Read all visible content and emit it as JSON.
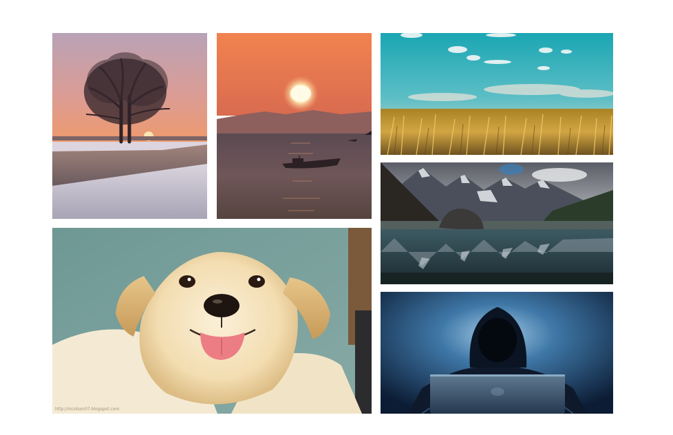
{
  "gallery": {
    "tiles": [
      {
        "id": "tree",
        "subject": "bare-tree-winter-sunset"
      },
      {
        "id": "sun",
        "subject": "sunset-over-sea-with-boat"
      },
      {
        "id": "field",
        "subject": "golden-grass-field-blue-sky"
      },
      {
        "id": "mtn",
        "subject": "mountain-lake-reflection"
      },
      {
        "id": "puppy",
        "subject": "smiling-labrador-puppy",
        "watermark": "http://nicolson07.blogspot.com"
      },
      {
        "id": "hacker",
        "subject": "hooded-figure-with-laptop"
      }
    ]
  },
  "colors": {
    "background": "#ffffff"
  }
}
